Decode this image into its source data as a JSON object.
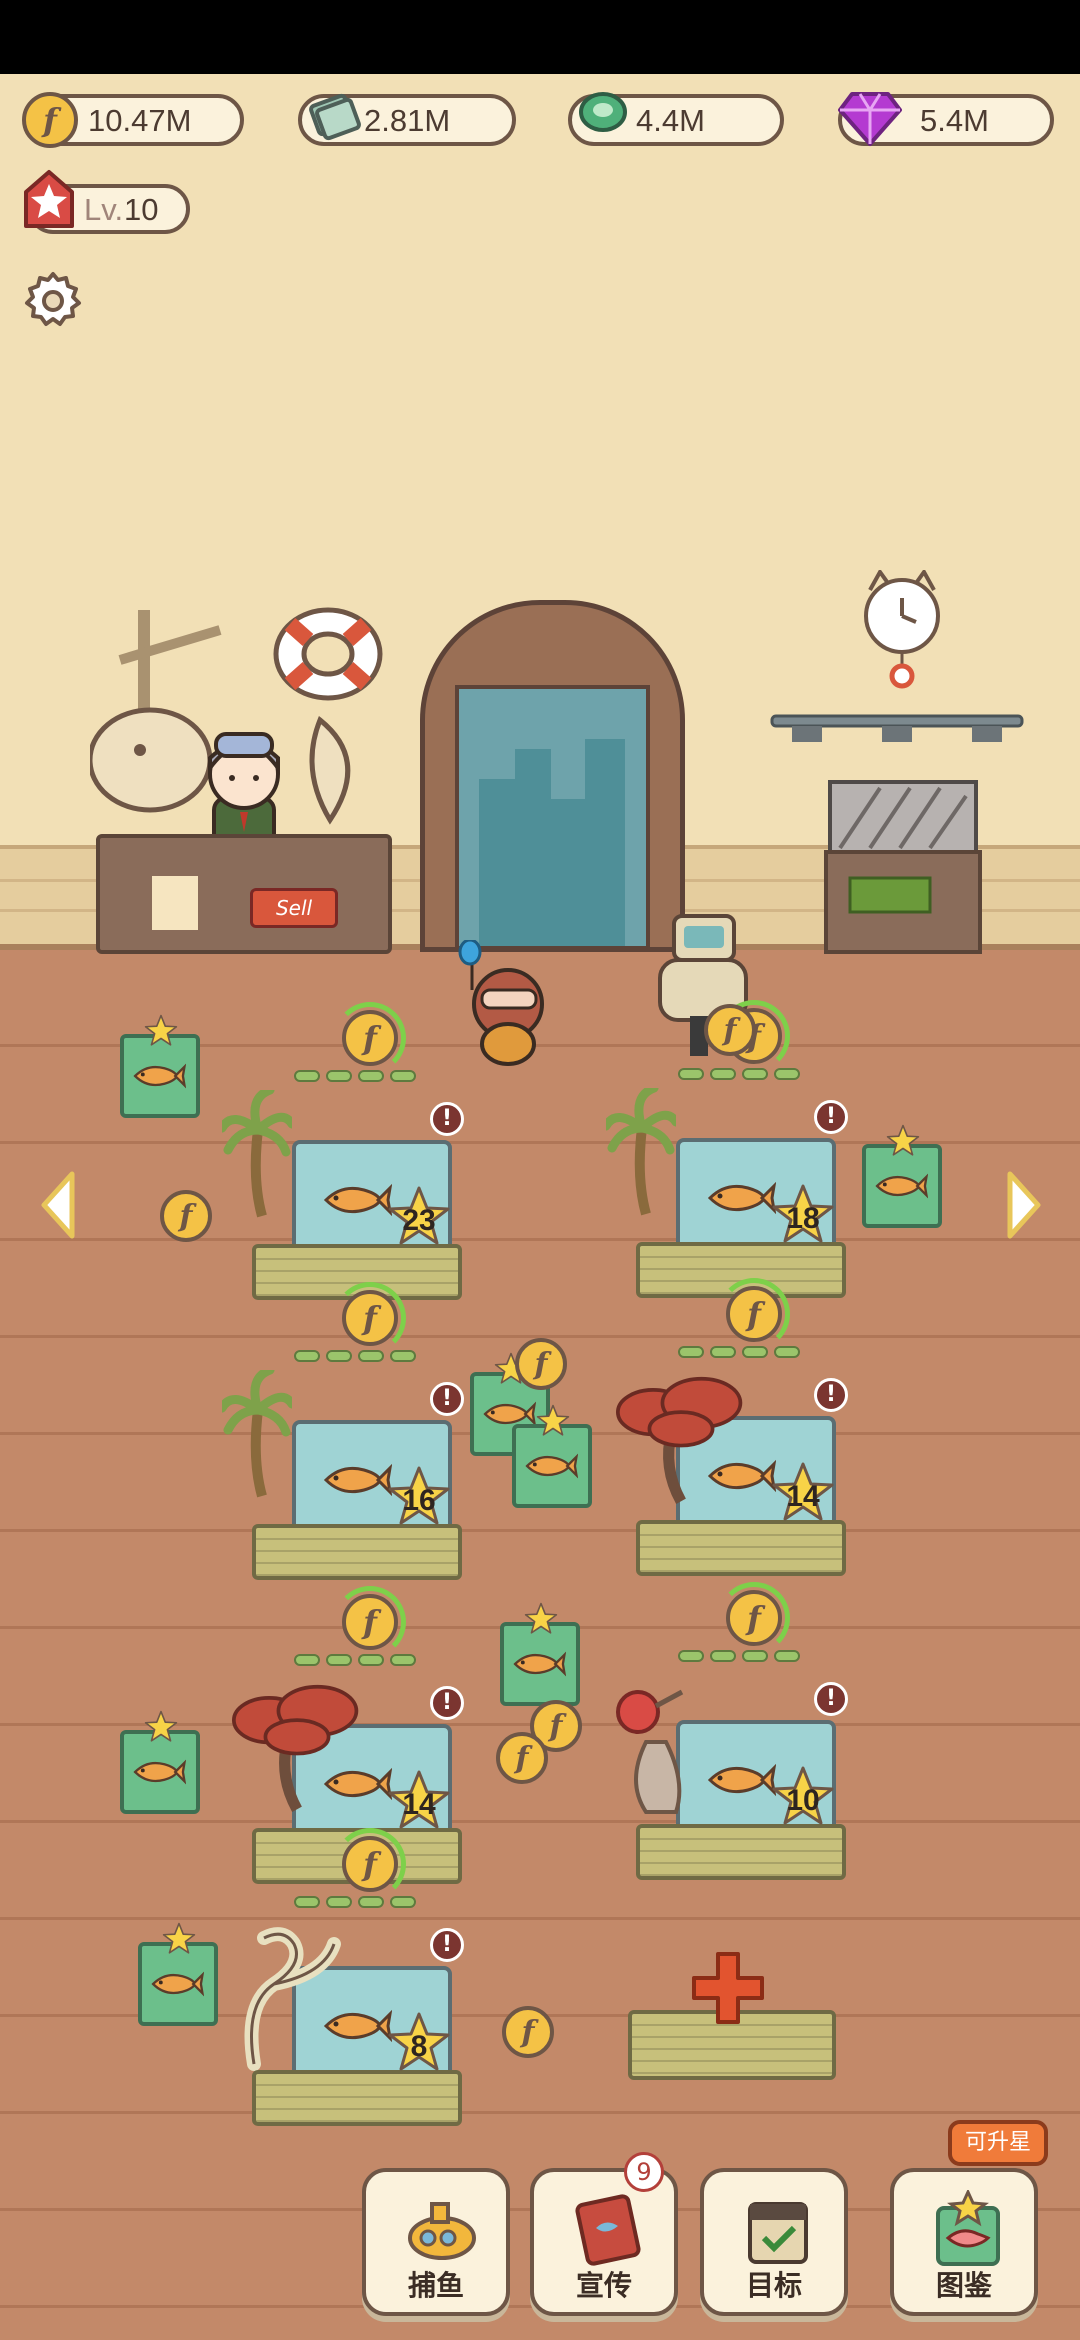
{
  "currencies": {
    "coins": "10.47M",
    "cash": "2.81M",
    "gems_green": "4.4M",
    "gems_purple": "5.4M"
  },
  "player": {
    "level_prefix": "Lv.",
    "level_value": "10"
  },
  "shop": {
    "sign": "Sell"
  },
  "tanks": [
    {
      "stars": "23",
      "decor": "palm"
    },
    {
      "stars": "18",
      "decor": "palm"
    },
    {
      "stars": "16",
      "decor": "palm"
    },
    {
      "stars": "14",
      "decor": "red-tree"
    },
    {
      "stars": "14",
      "decor": "red-tree"
    },
    {
      "stars": "10",
      "decor": "potion-rock"
    },
    {
      "stars": "8",
      "decor": "swirl-cloud"
    }
  ],
  "bottom_nav": {
    "fishing": "捕鱼",
    "promote": "宣传",
    "promote_badge": "9",
    "goals": "目标",
    "catalog": "图鉴",
    "catalog_tip": "可升星"
  },
  "colors": {
    "wall": "#f2e0b6",
    "floor": "#c38969",
    "coin": "#f4c246",
    "outline": "#6e5646"
  }
}
